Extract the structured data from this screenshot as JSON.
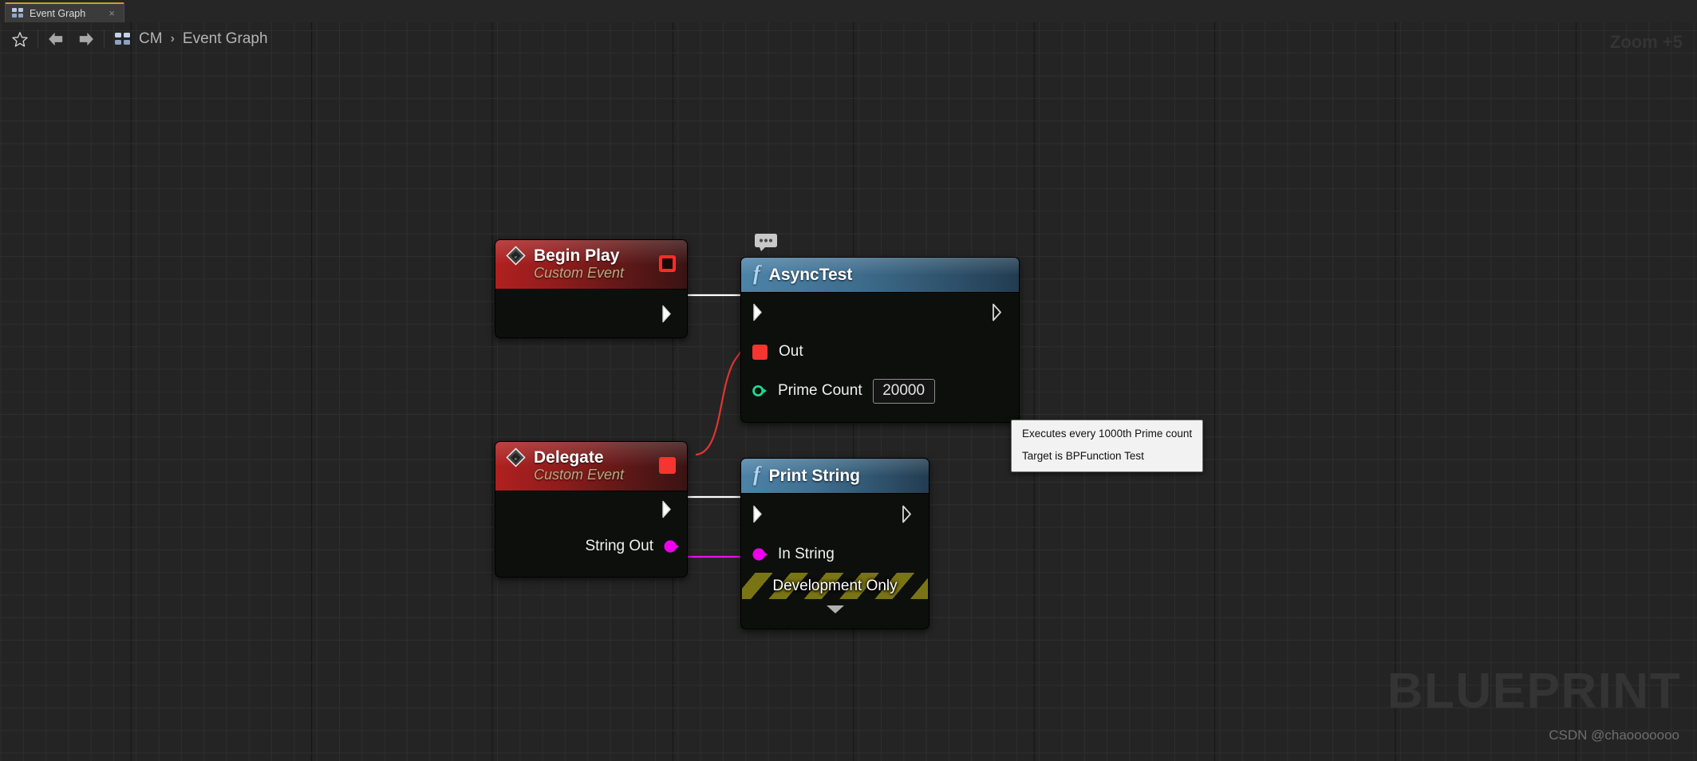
{
  "tab": {
    "label": "Event Graph",
    "icon": "graph-icon",
    "close_label": "×"
  },
  "toolbar": {
    "favorite_icon": "star-icon",
    "back_icon": "arrow-left-icon",
    "forward_icon": "arrow-right-icon",
    "breadcrumb_icon": "graph-icon",
    "breadcrumb": {
      "root": "CM",
      "separator": "›",
      "current": "Event Graph"
    },
    "zoom_label": "Zoom +5"
  },
  "graph": {
    "nodes": [
      {
        "id": "begin-play",
        "kind": "event",
        "title": "Begin Play",
        "subtitle": "Custom Event",
        "delegate_pin": "hollow",
        "exec_out": "",
        "icon": "event-diamond-icon"
      },
      {
        "id": "asynctest",
        "kind": "function",
        "title": "AsyncTest",
        "glyph": "f",
        "comment_icon": "comment-bubble-icon",
        "pins": [
          {
            "name": "exec-in",
            "label": ""
          },
          {
            "name": "exec-out",
            "label": ""
          },
          {
            "name": "out-delegate",
            "label": "Out"
          },
          {
            "name": "prime-count",
            "label": "Prime Count",
            "value": "20000"
          }
        ]
      },
      {
        "id": "delegate",
        "kind": "event",
        "title": "Delegate",
        "subtitle": "Custom Event",
        "delegate_pin": "solid",
        "string_out_label": "String Out",
        "icon": "event-diamond-icon"
      },
      {
        "id": "print-string",
        "kind": "function",
        "title": "Print String",
        "glyph": "f",
        "pins": [
          {
            "name": "exec-in",
            "label": ""
          },
          {
            "name": "exec-out",
            "label": ""
          },
          {
            "name": "in-string",
            "label": "In String"
          }
        ],
        "dev_only_label": "Development Only"
      }
    ],
    "colors": {
      "exec_wire": "#ffffff",
      "delegate_wire": "#e0352f",
      "string_wire": "#ef0fef",
      "delegate_pin": "#f5352f",
      "string_pin": "#ee00ee",
      "int_pin": "#1bd98c",
      "function_header": "#3f6e8e",
      "event_header": "#a01e1e",
      "dev_only_stripe": "#7a7514"
    }
  },
  "tooltip": {
    "line1": "Executes every 1000th Prime count",
    "line2": "Target is BPFunction Test"
  },
  "watermark": {
    "text": "BLUEPRINT",
    "credit": "CSDN @chaooooooo"
  }
}
